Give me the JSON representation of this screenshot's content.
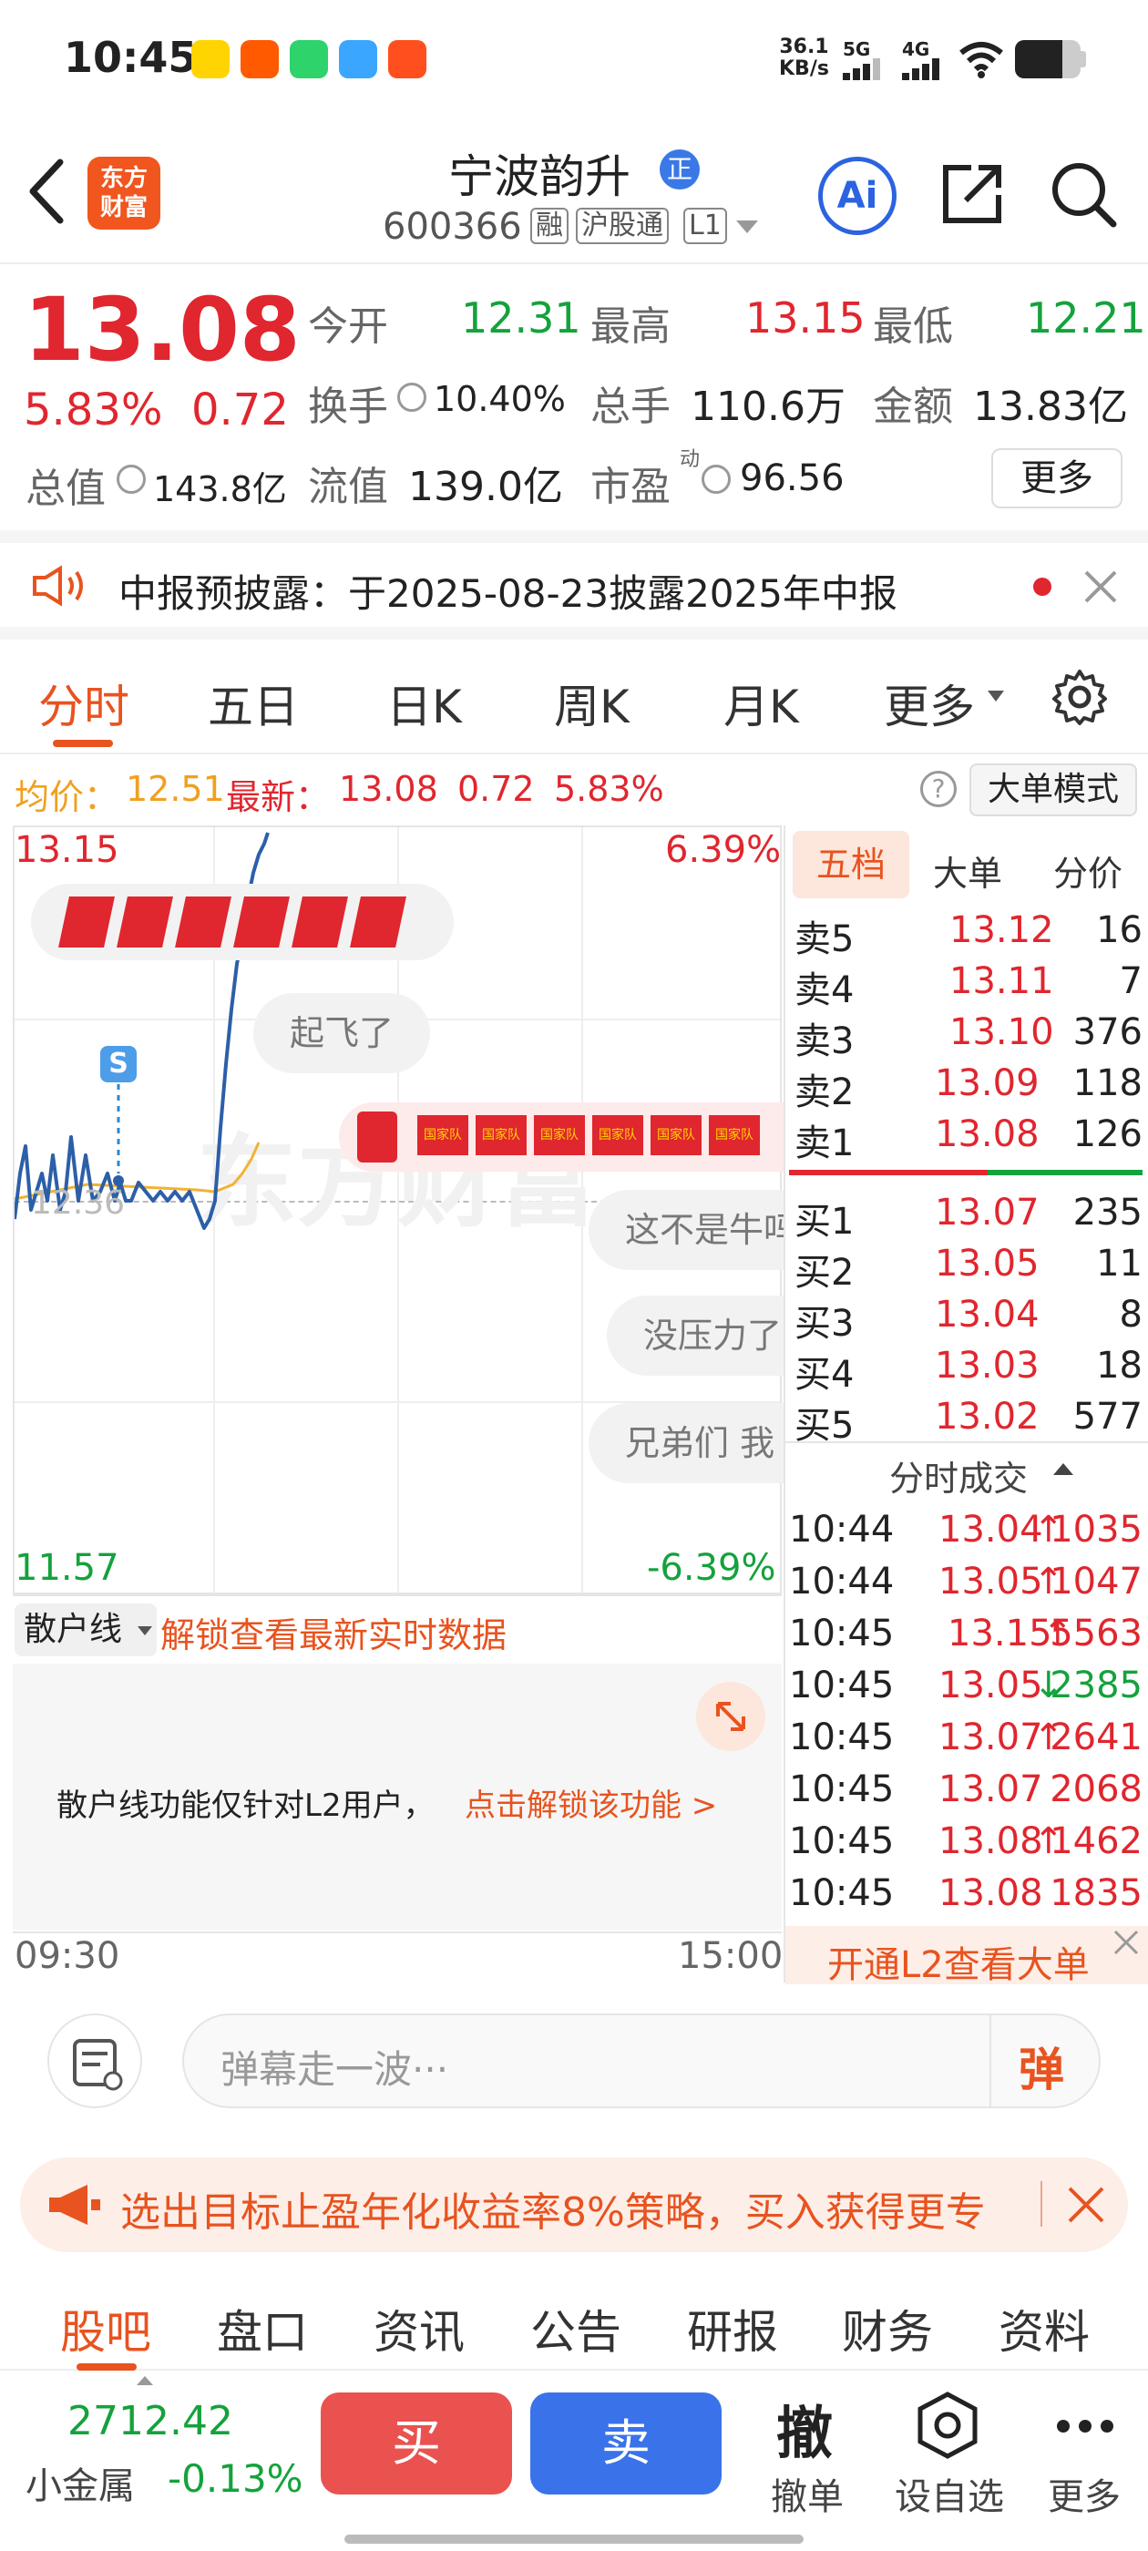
{
  "status": {
    "time": "10:45",
    "net_speed_top": "36.1",
    "net_speed_bottom": "KB/s",
    "sig1": "5G",
    "sig2": "4G"
  },
  "header": {
    "name": "宁波韵升",
    "name_badge": "正",
    "code": "600366",
    "tags": [
      "融",
      "沪股通",
      "L1"
    ],
    "logo_line1": "东方",
    "logo_line2": "财富",
    "ai_label": "Ai"
  },
  "quote": {
    "price": "13.08",
    "pct": "5.83%",
    "chg": "0.72",
    "open_label": "今开",
    "open": "12.31",
    "high_label": "最高",
    "high": "13.15",
    "low_label": "最低",
    "low": "12.21",
    "turnover_label": "换手",
    "turnover": "10.40%",
    "volume_label": "总手",
    "volume": "110.6万",
    "amount_label": "金额",
    "amount": "13.83亿",
    "mcap_label": "总值",
    "mcap": "143.8亿",
    "float_label": "流值",
    "float": "139.0亿",
    "pe_label": "市盈",
    "pe_sup": "动",
    "pe": "96.56",
    "more_label": "更多"
  },
  "notice": {
    "text": "中报预披露：于2025-08-23披露2025年中报"
  },
  "tabs": [
    "分时",
    "五日",
    "日K",
    "周K",
    "月K",
    "更多"
  ],
  "info_line": {
    "avg_label": "均价：",
    "avg": "12.51",
    "latest_label": "最新：",
    "latest": "13.08",
    "chg": "0.72",
    "pct": "5.83%",
    "mode_btn": "大单模式"
  },
  "chart": {
    "y_top": "13.15",
    "y_bottom": "11.57",
    "y_mid": "12.36",
    "pct_top": "6.39%",
    "pct_bottom": "-6.39%",
    "time_start": "09:30",
    "time_end": "15:00",
    "marker": "S",
    "watermark": "东方财富",
    "flag_text": "国家队"
  },
  "danmu": [
    "起飞了",
    "这不是牛吗",
    "没压力了",
    "兄弟们 我"
  ],
  "retail": {
    "select": "散户线",
    "unlock": "解锁查看最新实时数据",
    "desc": "散户线功能仅针对L2用户，",
    "link": "点击解锁该功能 >"
  },
  "orderbook": {
    "tabs": [
      "五档",
      "大单",
      "分价"
    ],
    "asks": [
      {
        "label": "卖5",
        "price": "13.12",
        "vol": "16"
      },
      {
        "label": "卖4",
        "price": "13.11",
        "vol": "7"
      },
      {
        "label": "卖3",
        "price": "13.10",
        "vol": "376"
      },
      {
        "label": "卖2",
        "price": "13.09",
        "vol": "118"
      },
      {
        "label": "卖1",
        "price": "13.08",
        "vol": "126"
      }
    ],
    "bids": [
      {
        "label": "买1",
        "price": "13.07",
        "vol": "235"
      },
      {
        "label": "买2",
        "price": "13.05",
        "vol": "11"
      },
      {
        "label": "买3",
        "price": "13.04",
        "vol": "8"
      },
      {
        "label": "买4",
        "price": "13.03",
        "vol": "18"
      },
      {
        "label": "买5",
        "price": "13.02",
        "vol": "577"
      }
    ]
  },
  "ticks": {
    "title": "分时成交",
    "rows": [
      {
        "time": "10:44",
        "price": "13.04",
        "arrow": "↑",
        "vol": "1035",
        "color": "red"
      },
      {
        "time": "10:44",
        "price": "13.05",
        "arrow": "↑",
        "vol": "1047",
        "color": "red"
      },
      {
        "time": "10:45",
        "price": "13.15",
        "arrow": "↑",
        "vol": "5563",
        "color": "red"
      },
      {
        "time": "10:45",
        "price": "13.05",
        "arrow": "↓",
        "vol": "2385",
        "color": "green"
      },
      {
        "time": "10:45",
        "price": "13.07",
        "arrow": "↑",
        "vol": "2641",
        "color": "red"
      },
      {
        "time": "10:45",
        "price": "13.07",
        "arrow": "",
        "vol": "2068",
        "color": "red"
      },
      {
        "time": "10:45",
        "price": "13.08",
        "arrow": "↑",
        "vol": "1462",
        "color": "red"
      },
      {
        "time": "10:45",
        "price": "13.08",
        "arrow": "",
        "vol": "1835",
        "color": "red"
      }
    ],
    "l2_label": "开通L2查看大单"
  },
  "danmu_input": {
    "placeholder": "弹幕走一波···",
    "send": "弹"
  },
  "promo": {
    "text": "选出目标止盈年化收益率8%策略，买入获得更专"
  },
  "bottom_tabs": [
    "股吧",
    "盘口",
    "资讯",
    "公告",
    "研报",
    "财务",
    "资料"
  ],
  "trade": {
    "index_value": "2712.42",
    "index_name": "小金属",
    "index_pct": "-0.13%",
    "buy": "买",
    "sell": "卖",
    "cancel_icon": "撤",
    "cancel": "撤单",
    "watch": "设自选",
    "more": "更多"
  },
  "colors": {
    "up": "#e0262e",
    "down": "#14a23c",
    "accent": "#e8531f",
    "sell_btn": "#3a72ea",
    "buy_btn": "#e9524f"
  }
}
